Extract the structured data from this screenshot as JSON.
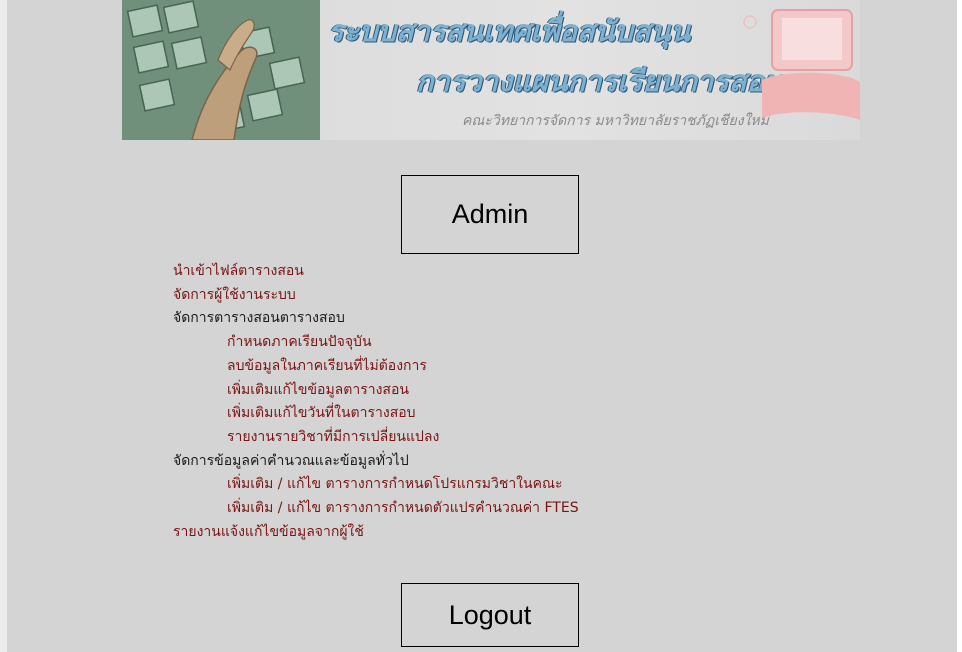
{
  "header": {
    "title_line1": "ระบบสารสนเทศเพื่อสนับสนุน",
    "title_line2": "การวางแผนการเรียนการสอน",
    "subtitle": "คณะวิทยาการจัดการ มหาวิทยาลัยราชภัฏเชียงใหม่"
  },
  "admin_label": "Admin",
  "menu": {
    "import_schedule": "นำเข้าไฟล์ตารางสอน",
    "manage_users": "จัดการผู้ใช้งานระบบ",
    "schedule_heading": "จัดการตารางสอนตารางสอบ",
    "set_current_semester": "กำหนดภาคเรียนปัจจุบัน",
    "delete_unwanted_data": "ลบข้อมูลในภาคเรียนที่ไม่ต้องการ",
    "edit_teaching_schedule": "เพิ่มเติมแก้ไขข้อมูลตารางสอน",
    "edit_exam_dates": "เพิ่มเติมแก้ไขวันที่ในตารางสอบ",
    "course_change_report": "รายงานรายวิชาที่มีการเปลี่ยนแปลง",
    "calc_heading": "จัดการข้อมูลค่าคำนวณและข้อมูลทั่วไป",
    "edit_program_table": "เพิ่มเติม / แก้ไข ตารางการกำหนดโปรแกรมวิชาในคณะ",
    "edit_ftes_table": "เพิ่มเติม / แก้ไข ตารางการกำหนดตัวแปรคำนวณค่า FTES",
    "user_correction_reports": "รายงานแจ้งแก้ไขข้อมูลจากผู้ใช้"
  },
  "logout_label": "Logout"
}
